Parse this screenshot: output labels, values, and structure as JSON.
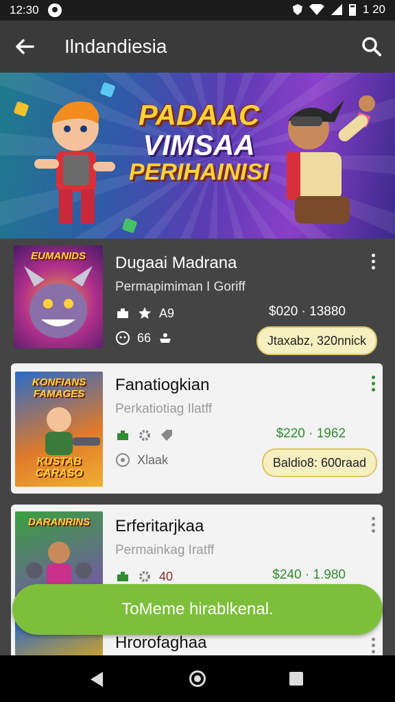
{
  "status_bar": {
    "time": "12:30",
    "right_time": "1 20"
  },
  "app_bar": {
    "title": "Ilndandiesia"
  },
  "banner": {
    "line1": "PADAAC",
    "line2": "VIMSAA",
    "line3": "PERIHAINISI"
  },
  "cards": [
    {
      "thumb_label": "EUMANIDS",
      "thumb_label2": "",
      "title": "Dugaai Madrana",
      "subtitle": "Permapimiman I Goriff",
      "rating": "A9",
      "meta2": "66",
      "price": "$020 · 13880",
      "pill": "Jtaxabz, 320nnick",
      "theme": "dark"
    },
    {
      "thumb_label": "KONFIANS FAMAGES",
      "thumb_label2": "KUSTAB CARASO",
      "title": "Fanatiogkian",
      "subtitle": "Perkatiotiag Ilatff",
      "rating": "",
      "meta2": "Xlaak",
      "price": "$220 · 1962",
      "pill": "Baldio8: 600raad",
      "theme": "light"
    },
    {
      "thumb_label": "DARANRINS",
      "thumb_label2": "",
      "title": "Erferitarjkaa",
      "subtitle": "Permainkag Iratff",
      "rating": "40",
      "meta2": "",
      "price": "$240 · 1.980",
      "pill": "",
      "theme": "light"
    },
    {
      "thumb_label": "",
      "thumb_label2": "",
      "title": "Hrorofaghaa",
      "subtitle": "",
      "rating": "",
      "meta2": "",
      "price": "",
      "pill": "",
      "theme": "light"
    }
  ],
  "toast": {
    "text": "ToMeme hirablkenal."
  },
  "colors": {
    "accent_green": "#7dbf3a",
    "price_green": "#2e8b2e",
    "pill_bg": "#f6efc0"
  }
}
